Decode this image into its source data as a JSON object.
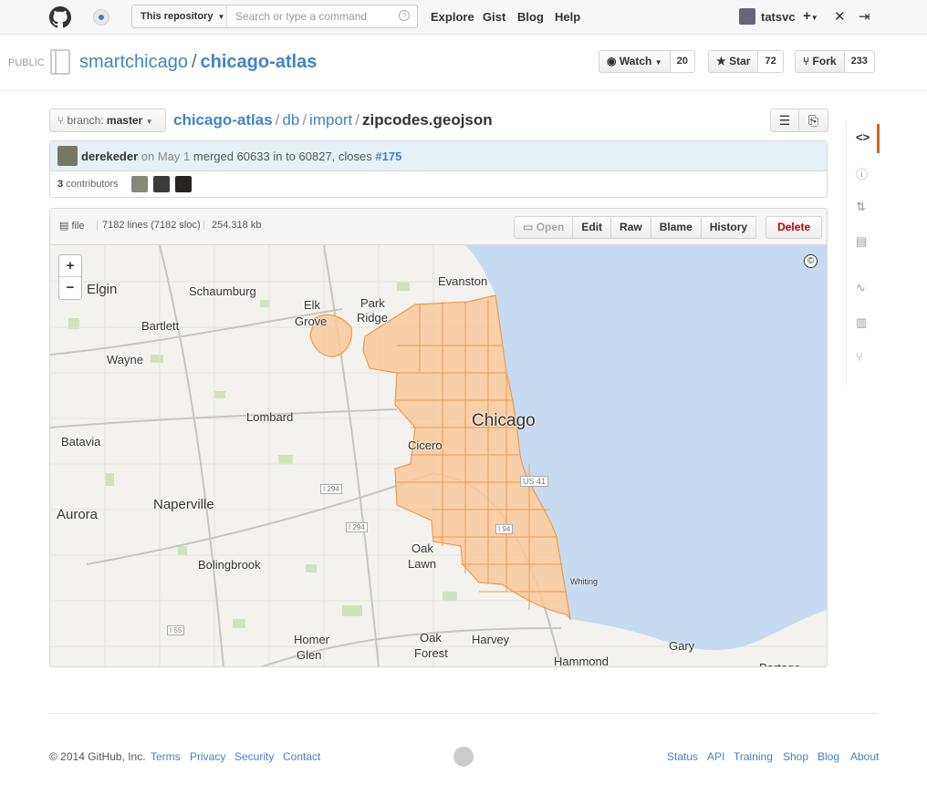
{
  "header": {
    "scope_label": "This repository",
    "search_placeholder": "Search or type a command",
    "nav": [
      "Explore",
      "Gist",
      "Blog",
      "Help"
    ],
    "username": "tatsvc"
  },
  "repo": {
    "visibility": "PUBLIC",
    "owner": "smartchicago",
    "name": "chicago-atlas",
    "watch_label": "Watch",
    "watch_count": "20",
    "star_label": "Star",
    "star_count": "72",
    "fork_label": "Fork",
    "fork_count": "233"
  },
  "file_nav": {
    "branch_prefix": "branch:",
    "branch": "master",
    "path": [
      "chicago-atlas",
      "db",
      "import"
    ],
    "filename": "zipcodes.geojson"
  },
  "commit": {
    "author": "derekeder",
    "date": "on May 1",
    "message": "merged 60633 in to 60827, closes",
    "issue": "#175",
    "contributors_count": "3",
    "contributors_label": "contributors"
  },
  "file_meta": {
    "type": "file",
    "lines": "7182 lines (7182 sloc)",
    "size": "254.318 kb",
    "buttons": [
      "Open",
      "Edit",
      "Raw",
      "Blame",
      "History"
    ],
    "delete_label": "Delete"
  },
  "map": {
    "zoom_in": "+",
    "zoom_out": "−",
    "attribution": "©",
    "places": [
      "Elgin",
      "Schaumburg",
      "Evanston",
      "Elk",
      "Grove",
      "Park",
      "Ridge",
      "Bartlett",
      "Wayne",
      "Lombard",
      "Chicago",
      "Batavia",
      "Cicero",
      "US 41",
      "I 294",
      "Naperville",
      "Aurora",
      "I 294",
      "I 94",
      "Oak",
      "Lawn",
      "Bolingbrook",
      "Whiting",
      "I 55",
      "Homer",
      "Glen",
      "Oak",
      "Forest",
      "Harvey",
      "Gary",
      "Hammond",
      "Portage"
    ],
    "colors": {
      "water": "#c6daf2",
      "land": "#f3f2ee",
      "zip_fill": "#f7c99b",
      "zip_stroke": "#ef9a48"
    }
  },
  "sidenav": {
    "icons": [
      "code-icon",
      "issues-icon",
      "pull-request-icon",
      "wiki-icon",
      "pulse-icon",
      "graphs-icon",
      "network-icon"
    ]
  },
  "footer": {
    "copyright": "© 2014 GitHub, Inc.",
    "left_links": [
      "Terms",
      "Privacy",
      "Security",
      "Contact"
    ],
    "right_links": [
      "Status",
      "API",
      "Training",
      "Shop",
      "Blog",
      "About"
    ]
  }
}
